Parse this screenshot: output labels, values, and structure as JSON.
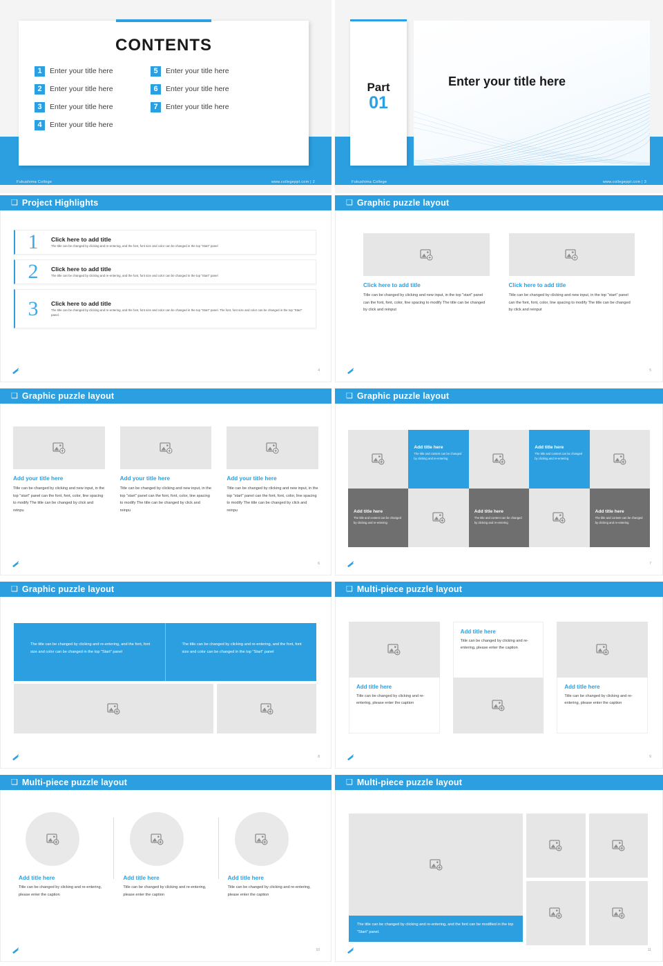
{
  "brand": {
    "accent": "#2b9fe0",
    "dark_tile": "#6f6f6f",
    "grey_tile": "#e6e6e6"
  },
  "footer": {
    "org": "Fukushima College",
    "site": "www.collegeppt.com  |"
  },
  "slides": [
    {
      "id": "contents",
      "page": "2",
      "title": "CONTENTS",
      "items": [
        {
          "num": "1",
          "label": "Enter your title here"
        },
        {
          "num": "2",
          "label": "Enter your title here"
        },
        {
          "num": "3",
          "label": "Enter your title here"
        },
        {
          "num": "4",
          "label": "Enter your title here"
        },
        {
          "num": "5",
          "label": "Enter your title here"
        },
        {
          "num": "6",
          "label": "Enter your title here"
        },
        {
          "num": "7",
          "label": "Enter your title here"
        }
      ]
    },
    {
      "id": "part",
      "page": "3",
      "part_word": "Part",
      "part_num": "01",
      "hero_title": "Enter your title here"
    },
    {
      "id": "highlights",
      "page": "4",
      "header": "Project Highlights",
      "rows": [
        {
          "num": "1",
          "title": "Click here to add title",
          "desc": "The title can be changed by clicking and re-entering, and the font, font size and color can be changed in the top \"Start\" panel"
        },
        {
          "num": "2",
          "title": "Click here to add title",
          "desc": "The title can be changed by clicking and re-entering, and the font, font size and color can be changed in the top \"Start\" panel"
        },
        {
          "num": "3",
          "title": "Click here to add title",
          "desc": "The title can be changed by clicking and re-entering, and the font, font size and color can be changed in the top \"Start\" panel. The font, font size and color can be changed in the top \"Start\" panel."
        }
      ]
    },
    {
      "id": "two-col",
      "page": "5",
      "header": "Graphic puzzle layout",
      "cols": [
        {
          "title": "Click here to add title",
          "body": "Title can be changed by clicking and new input, in the top \"start\" panel can the font, font, color, line spacing to modify The title can be changed by click and reinput"
        },
        {
          "title": "Click here to add title",
          "body": "Title can be changed by clicking and new input, in the top \"start\" panel can the font, font, color, line spacing to modify The title can be changed by click and reinput"
        }
      ]
    },
    {
      "id": "three-col",
      "page": "6",
      "header": "Graphic puzzle layout",
      "cols": [
        {
          "title": "Add your title here",
          "body": "Title can be changed by clicking and new input, in the top \"start\" panel can the font, font, color, line spacing to modify The title can be changed by click and reinpu"
        },
        {
          "title": "Add your title here",
          "body": "Title can be changed by clicking and new input, in the top \"start\" panel can the font, font, color, line spacing to modify The title can be changed by click and reinpu"
        },
        {
          "title": "Add your title here",
          "body": "Title can be changed by clicking and new input, in the top \"start\" panel can the font, font, color, line spacing to modify The title can be changed by click and reinpu"
        }
      ]
    },
    {
      "id": "mosaic",
      "page": "7",
      "header": "Graphic puzzle layout",
      "tiles": [
        {
          "kind": "image",
          "style": "grey"
        },
        {
          "kind": "text",
          "style": "blue",
          "title": "Add title here",
          "body": "The title and content can be changed by clicking and re-entering"
        },
        {
          "kind": "image",
          "style": "grey"
        },
        {
          "kind": "text",
          "style": "blue",
          "title": "Add title here",
          "body": "The title and content can be changed by clicking and re-entering"
        },
        {
          "kind": "image",
          "style": "grey"
        },
        {
          "kind": "text",
          "style": "dark",
          "title": "Add title here",
          "body": "The title and content can be changed by clicking and re-entering"
        },
        {
          "kind": "image",
          "style": "grey"
        },
        {
          "kind": "text",
          "style": "dark",
          "title": "Add title here",
          "body": "The title and content can be changed by clicking and re-entering"
        },
        {
          "kind": "image",
          "style": "grey"
        },
        {
          "kind": "text",
          "style": "dark",
          "title": "Add title here",
          "body": "The title and content can be changed by clicking and re-entering"
        }
      ]
    },
    {
      "id": "banner",
      "page": "8",
      "header": "Graphic puzzle layout",
      "banner": [
        "The title can be changed by clicking and re-entering, and the font, font size and color can be changed in the top \"Start\" panel",
        "The title can be changed by clicking and re-entering, and the font, font size and color can be changed in the top \"Start\" panel"
      ]
    },
    {
      "id": "mixed",
      "page": "9",
      "header": "Multi-piece puzzle layout",
      "cols": [
        {
          "order": "image-first",
          "title": "Add title here",
          "body": "Title can be changed by clicking and re-entering, please enter the caption"
        },
        {
          "order": "text-first",
          "title": "Add title here",
          "body": "Title can be changed by clicking and re-entering, please enter the caption"
        },
        {
          "order": "image-first",
          "title": "Add title here",
          "body": "Title can be changed by clicking and re-entering, please enter the caption"
        }
      ]
    },
    {
      "id": "circles",
      "page": "10",
      "header": "Multi-piece puzzle layout",
      "cols": [
        {
          "title": "Add title here",
          "body": "Title can be changed by clicking and re-entering, please enter the caption"
        },
        {
          "title": "Add title here",
          "body": "Title can be changed by clicking and re-entering, please enter the caption"
        },
        {
          "title": "Add title here",
          "body": "Title can be changed by clicking and re-entering, please enter the caption"
        }
      ]
    },
    {
      "id": "bigfour",
      "page": "11",
      "header": "Multi-piece puzzle layout",
      "caption": "The title can be changed by clicking and re-entering, and the font can be modified in the top \"Start\" panel."
    }
  ]
}
